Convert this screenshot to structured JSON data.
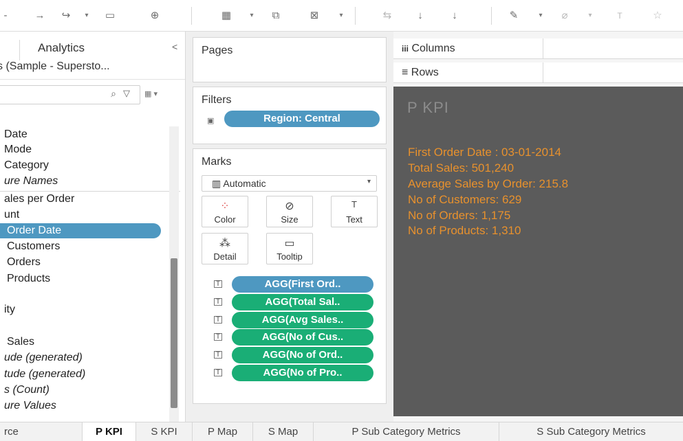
{
  "toolbar": {
    "forward": "→",
    "redo": "↪",
    "dropdown": "▾",
    "save": "▭",
    "new_datasource": "⊕",
    "new_worksheet": "▦",
    "duplicate": "⧉",
    "clear_sheet": "⊠",
    "swap": "⇆",
    "sort_asc": "↓",
    "sort_desc": "↓",
    "highlight": "✎",
    "group": "⌀",
    "label": "T",
    "fix_axes": "☆"
  },
  "data_pane": {
    "tab_label": "Analytics",
    "collapse": "<",
    "datasource": "s (Sample - Supersto...",
    "search_icon": "⌕",
    "filter_icon": "▽",
    "view_icon": "▦ ▾",
    "fields": [
      {
        "label": "Date",
        "style": "normal"
      },
      {
        "label": "Mode",
        "style": "normal"
      },
      {
        "label": "Category",
        "style": "normal"
      },
      {
        "label": "ure Names",
        "style": "italic"
      },
      {
        "label": "ales per Order",
        "style": "normal"
      },
      {
        "label": "unt",
        "style": "normal"
      },
      {
        "label": "Order Date",
        "style": "selected"
      },
      {
        "label": "Customers",
        "style": "normal"
      },
      {
        "label": "Orders",
        "style": "normal"
      },
      {
        "label": "Products",
        "style": "normal"
      },
      {
        "label": "ity",
        "style": "normal"
      },
      {
        "label": "Sales",
        "style": "normal"
      },
      {
        "label": "ude (generated)",
        "style": "italic"
      },
      {
        "label": "tude (generated)",
        "style": "italic"
      },
      {
        "label": "s (Count)",
        "style": "italic"
      },
      {
        "label": "ure Values",
        "style": "italic"
      }
    ]
  },
  "pages": {
    "title": "Pages"
  },
  "filters": {
    "title": "Filters",
    "pill": "Region: Central"
  },
  "marks": {
    "title": "Marks",
    "type": "Automatic",
    "type_icon": "▥",
    "dropdown_arrow": "▾",
    "buttons": {
      "color": {
        "label": "Color",
        "icon": "⁘"
      },
      "size": {
        "label": "Size",
        "icon": "⊘"
      },
      "text": {
        "label": "Text",
        "icon": "T"
      },
      "detail": {
        "label": "Detail",
        "icon": "⁂"
      },
      "tooltip": {
        "label": "Tooltip",
        "icon": "▭"
      }
    },
    "pill_icon": "T",
    "pills": [
      "AGG(First Ord..",
      "AGG(Total Sal..",
      "AGG(Avg Sales..",
      "AGG(No of Cus..",
      "AGG(No of Ord..",
      "AGG(No of Pro.."
    ]
  },
  "shelves": {
    "columns_icon": "iii",
    "columns": "Columns",
    "rows_icon": "≡",
    "rows": "Rows"
  },
  "view": {
    "title": "P KPI",
    "lines": [
      "First Order Date : 03-01-2014",
      "Total Sales: 501,240",
      "Average Sales by Order: 215.8",
      "No of Customers: 629",
      "No of Orders: 1,175",
      "No of Products: 1,310"
    ]
  },
  "sheet_tabs": [
    "rce",
    "P KPI",
    "S KPI",
    "P Map",
    "S Map",
    "P Sub Category Metrics",
    "S Sub Category Metrics"
  ],
  "colors": {
    "accent_blue": "#4e98c1",
    "pill_green": "#1aae76",
    "canvas_bg": "#5b5b5b",
    "kpi_orange": "#e8912d"
  }
}
